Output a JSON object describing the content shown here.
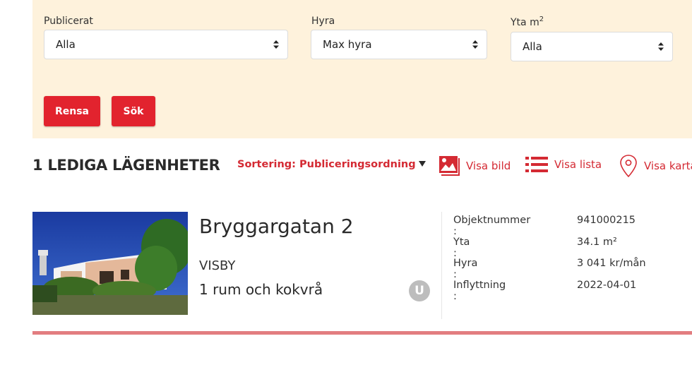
{
  "filters": {
    "publicerat": {
      "label": "Publicerat",
      "value": "Alla"
    },
    "hyra": {
      "label": "Hyra",
      "value": "Max hyra"
    },
    "yta": {
      "label": "Yta m",
      "label_sup": "2",
      "value": "Alla"
    }
  },
  "buttons": {
    "clear": "Rensa",
    "search": "Sök"
  },
  "results": {
    "count_text": "1 LEDIGA LÄGENHETER",
    "sort_text": "Sortering: Publiceringsordning",
    "views": {
      "image": "Visa bild",
      "list": "Visa lista",
      "map": "Visa karta"
    }
  },
  "listing": {
    "address": "Bryggargatan 2",
    "city": "VISBY",
    "rooms": "1 rum och kokvrå",
    "badge": "U",
    "facts": [
      {
        "label": "Objektnummer :",
        "value": "941000215"
      },
      {
        "label": "Yta :",
        "value": "34.1 m²"
      },
      {
        "label": "Hyra :",
        "value": "3 041 kr/mån"
      },
      {
        "label": "Inflyttning :",
        "value": "2022-04-01"
      }
    ]
  },
  "colors": {
    "accent": "#e2232e",
    "link": "#d42a33",
    "panel": "#fef2dc",
    "rule": "#e27d80"
  },
  "icons": [
    "chevron-up-down-icon",
    "image-icon",
    "list-icon",
    "map-pin-icon",
    "sort-triangle-icon"
  ]
}
